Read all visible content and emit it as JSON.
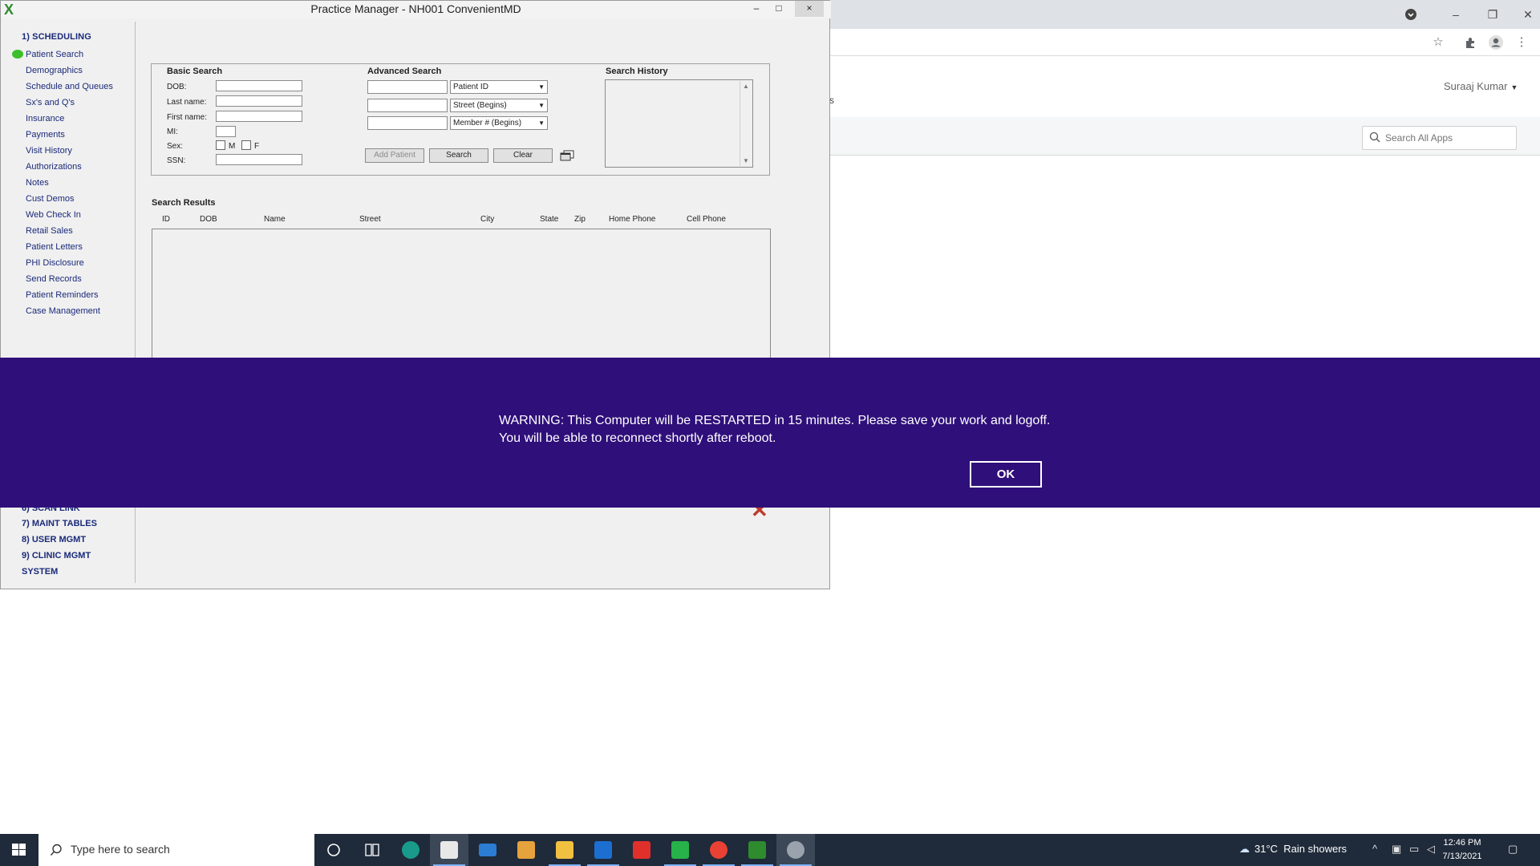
{
  "practice_manager": {
    "title": "Practice Manager - NH001 ConvenientMD",
    "minimize": "–",
    "maximize": "□",
    "close": "×",
    "sidebar": {
      "section_1": "1) SCHEDULING",
      "items": [
        "Patient Search",
        "Demographics",
        "Schedule and Queues",
        "Sx's and Q's",
        "Insurance",
        "Payments",
        "Visit History",
        "Authorizations",
        "Notes",
        "Cust Demos",
        "Web Check In",
        "Retail Sales",
        "Patient Letters",
        "PHI Disclosure",
        "Send Records",
        "Patient Reminders",
        "Case Management"
      ],
      "section_6_partial": "6) SCAN LINK",
      "section_7": "7) MAINT TABLES",
      "section_8": "8) USER MGMT",
      "section_9_line1": "9) CLINIC MGMT",
      "section_9_line2": "SYSTEM"
    },
    "basic_search": {
      "title": "Basic Search",
      "dob": "DOB:",
      "last_name": "Last name:",
      "first_name": "First name:",
      "mi": "MI:",
      "sex": "Sex:",
      "sex_m": "M",
      "sex_f": "F",
      "ssn": "SSN:"
    },
    "advanced_search": {
      "title": "Advanced Search",
      "dropdown_1": "Patient ID",
      "dropdown_2": "Street (Begins)",
      "dropdown_3": "Member # (Begins)"
    },
    "buttons": {
      "add_patient": "Add Patient",
      "search": "Search",
      "clear": "Clear"
    },
    "search_history": {
      "title": "Search History"
    },
    "results": {
      "title": "Search Results",
      "columns": [
        "ID",
        "DOB",
        "Name",
        "Street",
        "City",
        "State",
        "Zip",
        "Home Phone",
        "Cell Phone"
      ]
    }
  },
  "browser": {
    "user": "Suraaj Kumar",
    "app_search_placeholder": "Search All Apps",
    "stray_char": "s"
  },
  "banner": {
    "line1": "WARNING: This Computer will be RESTARTED in 15 minutes. Please save your work and logoff.",
    "line2": "You will be able to reconnect shortly after reboot.",
    "ok": "OK",
    "color": "#2f0f7a"
  },
  "taskbar": {
    "search_placeholder": "Type here to search",
    "weather_temp": "31°C",
    "weather_desc": "Rain showers",
    "time": "12:46 PM",
    "date": "7/13/2021"
  }
}
